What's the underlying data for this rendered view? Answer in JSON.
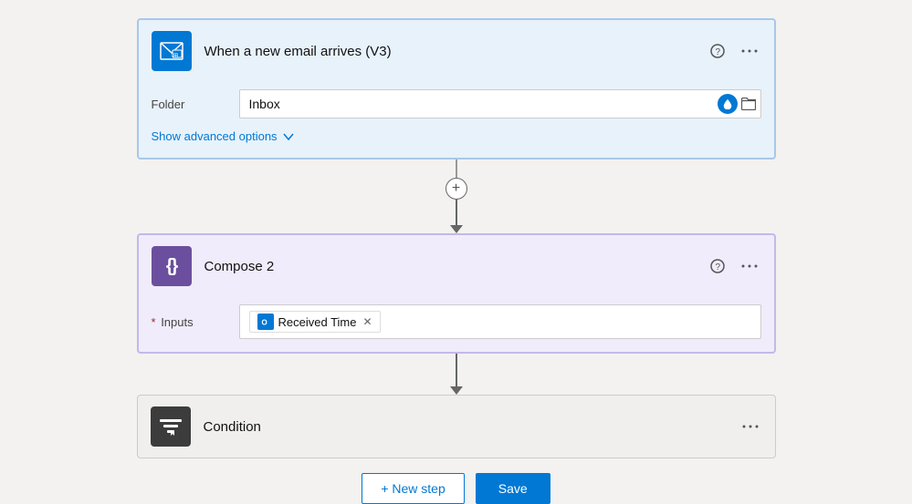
{
  "email_trigger": {
    "title": "When a new email arrives (V3)",
    "folder_label": "Folder",
    "folder_value": "Inbox",
    "advanced_link": "Show advanced options",
    "icon_aria": "email-trigger-icon",
    "help_aria": "?",
    "more_aria": "..."
  },
  "compose_card": {
    "title": "Compose 2",
    "inputs_label": "* Inputs",
    "tag_text": "Received Time",
    "icon_aria": "compose-icon",
    "help_aria": "?",
    "more_aria": "..."
  },
  "condition_card": {
    "title": "Condition",
    "icon_aria": "condition-icon",
    "more_aria": "..."
  },
  "bottom_bar": {
    "new_step_label": "+ New step",
    "save_label": "Save"
  },
  "connectors": {
    "plus_symbol": "+",
    "arrow": "↓"
  }
}
